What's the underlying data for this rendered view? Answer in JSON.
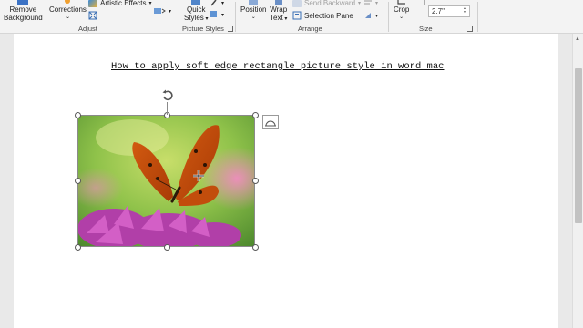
{
  "ribbon": {
    "remove_background": [
      "Remove",
      "Background"
    ],
    "corrections": "Corrections",
    "artistic_effects": "Artistic Effects",
    "adjust_label": "Adjust",
    "quick_styles": [
      "Quick",
      "Styles"
    ],
    "picture_styles_label": "Picture Styles",
    "position": "Position",
    "wrap_text": [
      "Wrap",
      "Text"
    ],
    "send_backward": "Send Backward",
    "selection_pane": "Selection Pane",
    "arrange_label": "Arrange",
    "crop": "Crop",
    "size_value": "2.7\"",
    "size_label": "Size"
  },
  "document": {
    "title": "How to apply soft edge rectangle picture style in word mac"
  },
  "colors": {
    "ribbon_bg": "#f3f3f3",
    "page_bg": "#ffffff",
    "workspace_bg": "#e9e9e9",
    "accent_blue": "#2b579a"
  },
  "icons": [
    "remove-background-icon",
    "corrections-icon",
    "artistic-effects-icon",
    "compress-icon",
    "change-picture-icon",
    "quick-styles-icon",
    "picture-border-icon",
    "position-icon",
    "wrap-text-icon",
    "send-backward-icon",
    "selection-pane-icon",
    "align-icon",
    "rotate-icon",
    "crop-icon",
    "rotate-handle-icon",
    "layout-options-icon"
  ]
}
